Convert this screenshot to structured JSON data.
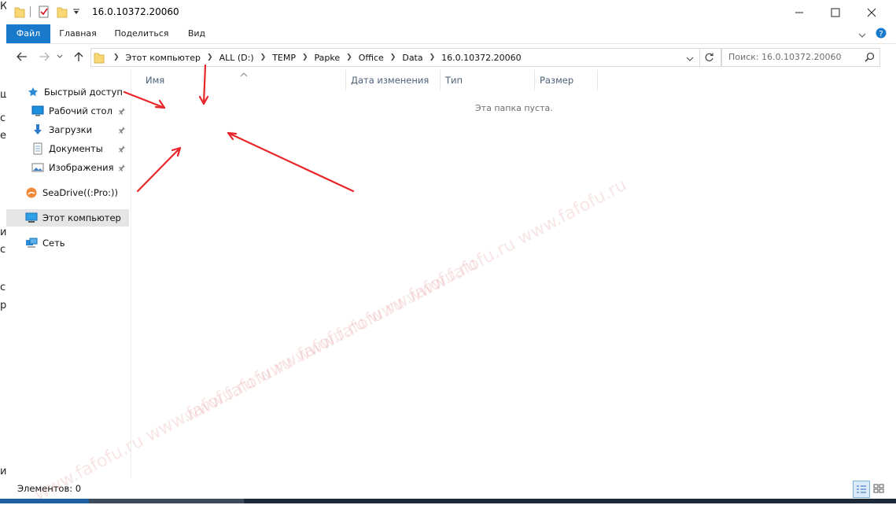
{
  "window": {
    "title": "16.0.10372.20060",
    "controls": {
      "minimize": "minimize",
      "maximize": "maximize",
      "close": "close"
    }
  },
  "ribbon": {
    "tabs": [
      "Файл",
      "Главная",
      "Поделиться",
      "Вид"
    ]
  },
  "address": {
    "crumbs": [
      "Этот компьютер",
      "ALL (D:)",
      "TEMP",
      "Papke",
      "Office",
      "Data",
      "16.0.10372.20060"
    ]
  },
  "search": {
    "placeholder": "Поиск: 16.0.10372.20060"
  },
  "sidebar": {
    "quick_access": "Быстрый доступ",
    "items": [
      {
        "label": "Рабочий стол",
        "icon": "desktop-icon",
        "pinned": true
      },
      {
        "label": "Загрузки",
        "icon": "downloads-icon",
        "pinned": true
      },
      {
        "label": "Документы",
        "icon": "documents-icon",
        "pinned": true
      },
      {
        "label": "Изображения",
        "icon": "pictures-icon",
        "pinned": true
      }
    ],
    "seadrive": "SeaDrive((:Pro:))",
    "this_pc": "Этот компьютер",
    "network": "Сеть"
  },
  "columns": [
    "Имя",
    "Дата изменения",
    "Тип",
    "Размер"
  ],
  "empty_message": "Эта папка пуста.",
  "status": {
    "items_text": "Элементов: 0"
  },
  "background_chars": [
    "К",
    "ш",
    "с",
    "е",
    "и",
    "с",
    "с",
    "р",
    "и"
  ],
  "watermark_text": "www.fafofu.ru www.fafofu.ru www.fafofu.ru www.fafofu.ru",
  "colors": {
    "accent": "#1979ca",
    "annotation_arrows": "#e8262a",
    "selected": "#e5e5e5"
  }
}
